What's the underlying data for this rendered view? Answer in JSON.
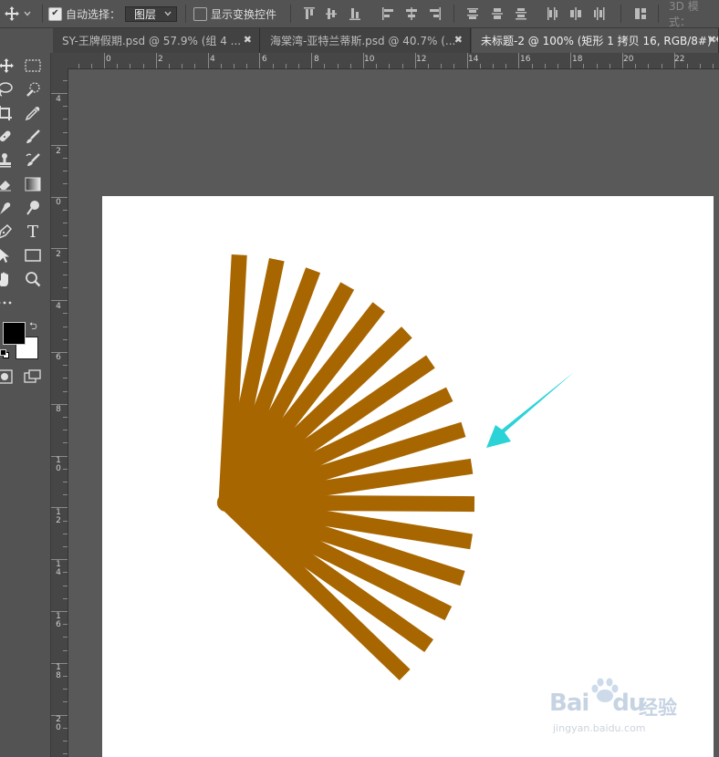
{
  "options_bar": {
    "auto_select_label": "自动选择：",
    "auto_select_checked": true,
    "layer_mode": "图层",
    "show_transform_label": "显示变换控件",
    "show_transform_checked": false,
    "mode_3d_label": "3D 模式："
  },
  "tabs": [
    {
      "label": "SY-王牌假期.psd @ 57.9% (组 4 ...",
      "active": false
    },
    {
      "label": "海棠湾-亚特兰蒂斯.psd @ 40.7% (...",
      "active": false
    },
    {
      "label": "未标题-2 @ 100% (矩形 1 拷贝 16, RGB/8#) *",
      "active": true
    }
  ],
  "rulers": {
    "horizontal": [
      "0",
      "2",
      "4",
      "6",
      "8",
      "10",
      "12",
      "14",
      "16",
      "18",
      "20",
      "22"
    ],
    "vertical": [
      "4",
      "2",
      "0",
      "2",
      "4",
      "6",
      "8",
      "10",
      "12",
      "14",
      "16",
      "18",
      "20"
    ]
  },
  "tools": [
    {
      "name": "move-tool",
      "icon": "move-icon"
    },
    {
      "name": "marquee-tool",
      "icon": "rect-marquee-icon"
    },
    {
      "name": "lasso-tool",
      "icon": "lasso-icon"
    },
    {
      "name": "quick-select-tool",
      "icon": "quick-select-icon"
    },
    {
      "name": "crop-tool",
      "icon": "crop-icon"
    },
    {
      "name": "eyedropper-tool",
      "icon": "eyedropper-icon"
    },
    {
      "name": "healing-tool",
      "icon": "bandage-icon"
    },
    {
      "name": "brush-tool",
      "icon": "brush-icon"
    },
    {
      "name": "stamp-tool",
      "icon": "stamp-icon"
    },
    {
      "name": "history-brush-tool",
      "icon": "history-brush-icon"
    },
    {
      "name": "eraser-tool",
      "icon": "eraser-icon"
    },
    {
      "name": "gradient-tool",
      "icon": "gradient-icon"
    },
    {
      "name": "smudge-tool",
      "icon": "smudge-icon"
    },
    {
      "name": "dodge-tool",
      "icon": "dodge-icon"
    },
    {
      "name": "pen-tool",
      "icon": "pen-icon"
    },
    {
      "name": "type-tool",
      "icon": "type-icon"
    },
    {
      "name": "path-select-tool",
      "icon": "arrow-icon"
    },
    {
      "name": "shape-tool",
      "icon": "rectangle-icon"
    },
    {
      "name": "hand-tool",
      "icon": "hand-icon"
    },
    {
      "name": "zoom-tool",
      "icon": "magnifier-icon"
    }
  ],
  "type_tool_glyph": "T",
  "colors": {
    "foreground": "#000000",
    "background": "#ffffff",
    "fan": "#a86600",
    "arrow": "#2bd3d6"
  },
  "watermark": {
    "brand": "Bai",
    "brand2": "du",
    "service": "经验",
    "url": "jingyan.baidu.com"
  }
}
